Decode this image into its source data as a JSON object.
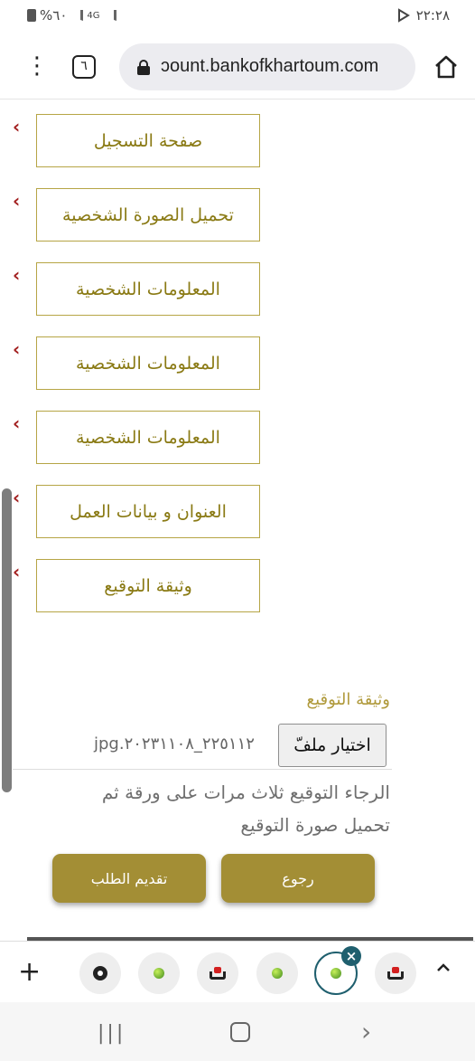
{
  "status_bar": {
    "battery": "%٦٠",
    "network": "4G",
    "time": "٢٢:٢٨"
  },
  "browser": {
    "menu_icon": "more-vert-icon",
    "tab_count": "٦",
    "url": "ccount.bankofkhartoum.com",
    "url_display": "ɔount.bankofkhartoum.com"
  },
  "steps": [
    {
      "label": "صفحة التسجيل"
    },
    {
      "label": "تحميل الصورة الشخصية"
    },
    {
      "label": "المعلومات الشخصية"
    },
    {
      "label": "المعلومات الشخصية"
    },
    {
      "label": "المعلومات الشخصية"
    },
    {
      "label": "العنوان و بيانات العمل"
    },
    {
      "label": "وثيقة التوقيع"
    }
  ],
  "signature": {
    "label": "وثيقة التوقيع",
    "choose_file": "اختيار ملفّ",
    "file_name": "jpg.٢٢٥١١٢_٢٠٢٣١١٠٨",
    "hint": "الرجاء التوقيع ثلاث مرات على ورقة ثم تحميل صورة التوقيع"
  },
  "actions": {
    "submit": "تقديم الطلب",
    "back": "رجوع"
  },
  "colors": {
    "accent": "#a38e35",
    "step_border": "#b6a545",
    "step_text": "#8a7a14",
    "chevron": "#a21f1f",
    "tab_active": "#1f5f6e"
  }
}
